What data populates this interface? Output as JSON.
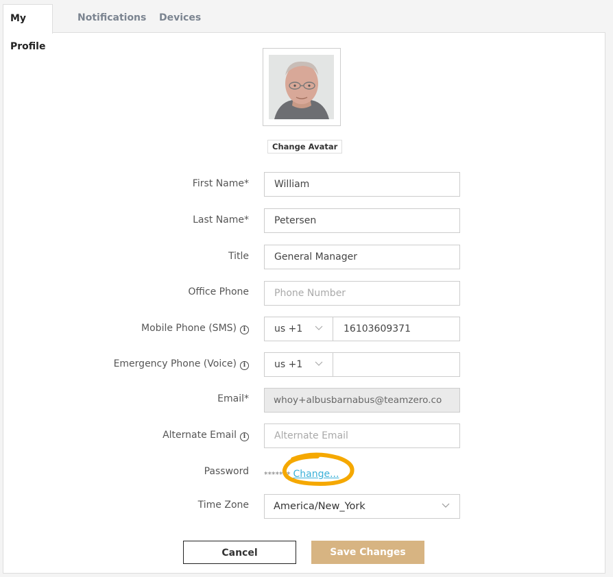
{
  "tabs": [
    {
      "label": "My Profile",
      "active": true
    },
    {
      "label": "Notifications",
      "active": false
    },
    {
      "label": "Devices",
      "active": false
    }
  ],
  "avatar": {
    "change_label": "Change Avatar"
  },
  "form": {
    "first_name": {
      "label": "First Name*",
      "value": "William"
    },
    "last_name": {
      "label": "Last Name*",
      "value": "Petersen"
    },
    "title": {
      "label": "Title",
      "value": "General Manager"
    },
    "office_phone": {
      "label": "Office Phone",
      "placeholder": "Phone Number"
    },
    "mobile_phone": {
      "label": "Mobile Phone (SMS)",
      "country": "us +1",
      "value": "16103609371"
    },
    "emergency_phone": {
      "label": "Emergency Phone (Voice)",
      "country": "us +1",
      "value": ""
    },
    "email": {
      "label": "Email*",
      "value": "whoy+albusbarnabus@teamzero.co"
    },
    "alternate_email": {
      "label": "Alternate Email",
      "placeholder": "Alternate Email"
    },
    "password": {
      "label": "Password",
      "mask": "*******",
      "change_label": "Change..."
    },
    "time_zone": {
      "label": "Time Zone",
      "value": "America/New_York"
    }
  },
  "buttons": {
    "cancel": "Cancel",
    "save": "Save Changes"
  },
  "colors": {
    "accent": "#d7b482",
    "link": "#3ab0d8",
    "highlight": "#f5a800"
  },
  "icons": [
    "info-icon",
    "chevron-down-icon"
  ]
}
